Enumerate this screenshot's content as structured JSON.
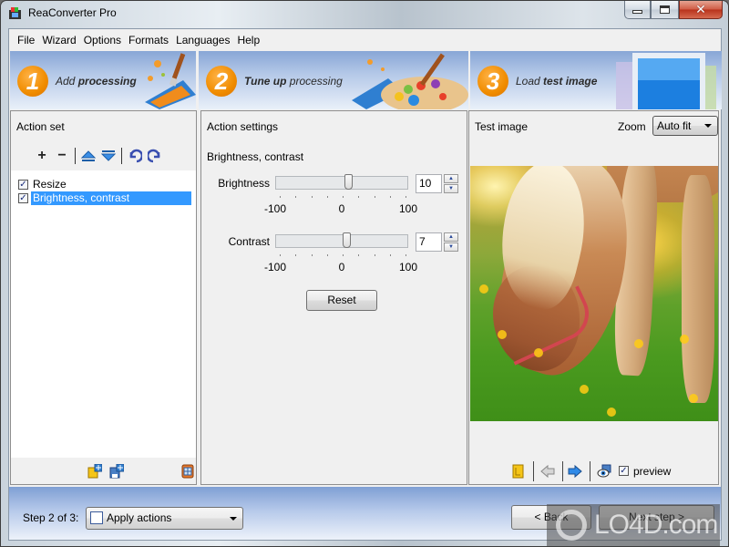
{
  "window": {
    "title": "ReaConverter Pro",
    "controls": {
      "minimize": "minimize",
      "maximize": "maximize",
      "close": "close"
    }
  },
  "menu": [
    "File",
    "Wizard",
    "Options",
    "Formats",
    "Languages",
    "Help"
  ],
  "steps": [
    {
      "number": "1",
      "label_plain": "Add ",
      "label_bold": "processing",
      "bold_first": false
    },
    {
      "number": "2",
      "label_bold": "Tune up",
      "label_plain": " processing",
      "bold_first": true
    },
    {
      "number": "3",
      "label_plain": "Load ",
      "label_bold": "test image",
      "bold_first": false
    }
  ],
  "action_set": {
    "title": "Action set",
    "toolbar": [
      "add-icon",
      "remove-icon",
      "move-up-icon",
      "move-down-icon",
      "undo-icon",
      "redo-icon"
    ],
    "items": [
      {
        "label": "Resize",
        "checked": true,
        "selected": false
      },
      {
        "label": "Brightness, contrast",
        "checked": true,
        "selected": true
      }
    ],
    "bottom_icons": [
      "open-actions-icon",
      "save-actions-icon",
      "action-properties-icon"
    ]
  },
  "action_settings": {
    "title": "Action settings",
    "section": "Brightness, contrast",
    "sliders": [
      {
        "label": "Brightness",
        "value": "10",
        "min": -100,
        "max": 100,
        "numeric": 10,
        "min_label": "-100",
        "mid_label": "0",
        "max_label": "100"
      },
      {
        "label": "Contrast",
        "value": "7",
        "min": -100,
        "max": 100,
        "numeric": 7,
        "min_label": "-100",
        "mid_label": "0",
        "max_label": "100"
      }
    ],
    "reset_label": "Reset"
  },
  "test_image": {
    "title": "Test image",
    "zoom_label": "Zoom",
    "zoom_value": "Auto fit",
    "image_alt": "Horse grazing in a meadow",
    "preview_label": "preview",
    "preview_checked": true
  },
  "footer": {
    "step_text": "Step 2 of 3:",
    "step_select": "Apply actions",
    "back_label": "< Back",
    "next_label": "Next step >"
  },
  "watermark": "LO4D.com"
}
